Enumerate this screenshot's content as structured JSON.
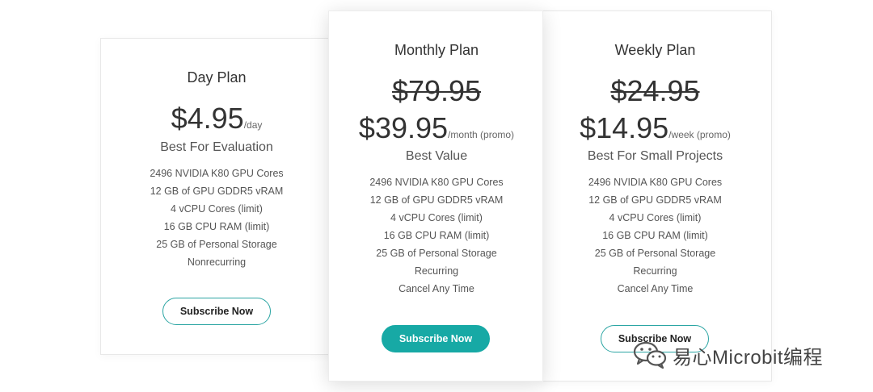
{
  "plans": [
    {
      "title": "Day Plan",
      "price": "$4.95",
      "unit": "/day",
      "tagline": "Best For Evaluation",
      "features": [
        "2496 NVIDIA K80 GPU Cores",
        "12 GB of GPU GDDR5 vRAM",
        "4 vCPU Cores (limit)",
        "16 GB CPU RAM (limit)",
        "25 GB of Personal Storage",
        "Nonrecurring"
      ],
      "button": "Subscribe Now"
    },
    {
      "title": "Monthly Plan",
      "old_price": "$79.95",
      "price": "$39.95",
      "unit": "/month (promo)",
      "tagline": "Best Value",
      "features": [
        "2496 NVIDIA K80 GPU Cores",
        "12 GB of GPU GDDR5 vRAM",
        "4 vCPU Cores (limit)",
        "16 GB CPU RAM (limit)",
        "25 GB of Personal Storage",
        "Recurring",
        "Cancel Any Time"
      ],
      "button": "Subscribe Now"
    },
    {
      "title": "Weekly Plan",
      "old_price": "$24.95",
      "price": "$14.95",
      "unit": "/week (promo)",
      "tagline": "Best For Small Projects",
      "features": [
        "2496 NVIDIA K80 GPU Cores",
        "12 GB of GPU GDDR5 vRAM",
        "4 vCPU Cores (limit)",
        "16 GB CPU RAM (limit)",
        "25 GB of Personal Storage",
        "Recurring",
        "Cancel Any Time"
      ],
      "button": "Subscribe Now"
    }
  ],
  "watermark": {
    "text": "易心Microbit编程",
    "icon": "wechat-icon"
  },
  "colors": {
    "accent": "#17a9a5",
    "outline_border": "#2ba5a3",
    "text": "#333333"
  }
}
